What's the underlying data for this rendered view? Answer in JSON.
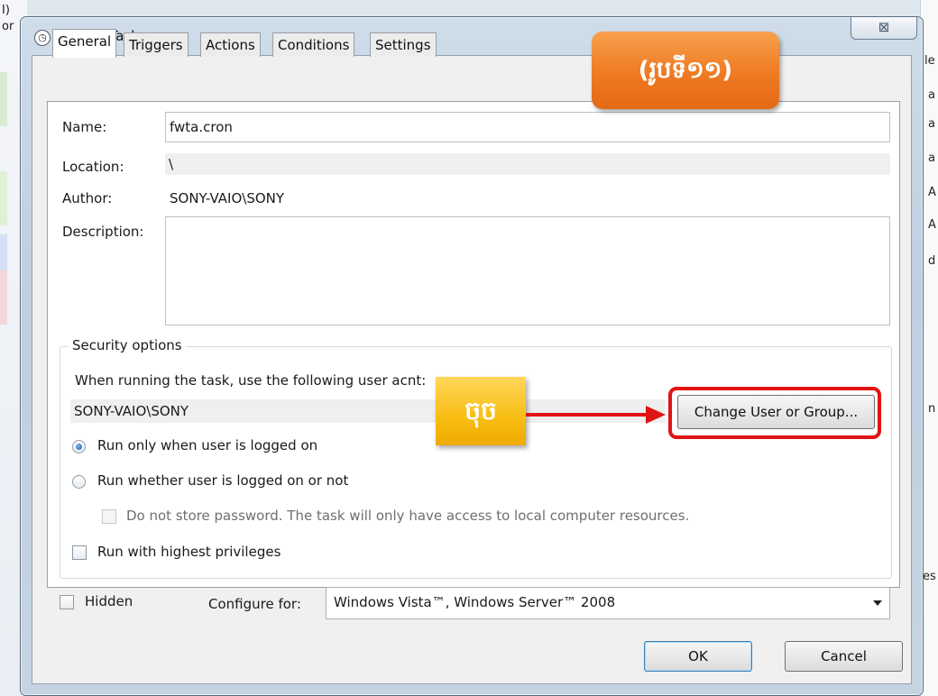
{
  "background": {
    "left_text": "I)",
    "left_text2": "or",
    "right_chars": [
      "le",
      "a",
      "a",
      "a",
      "A",
      "A",
      "d",
      "n",
      "es"
    ]
  },
  "window": {
    "title": "Create Task",
    "close_symbol": "⊠"
  },
  "tabs": [
    {
      "label": "General",
      "active": true
    },
    {
      "label": "Triggers",
      "active": false
    },
    {
      "label": "Actions",
      "active": false
    },
    {
      "label": "Conditions",
      "active": false
    },
    {
      "label": "Settings",
      "active": false
    }
  ],
  "general": {
    "name_label": "Name:",
    "name_value": "fwta.cron",
    "location_label": "Location:",
    "location_value": "\\",
    "author_label": "Author:",
    "author_value": "SONY-VAIO\\SONY",
    "description_label": "Description:",
    "description_value": ""
  },
  "security": {
    "group_title": "Security options",
    "prompt": "When running the task, use the following user ac",
    "prompt_tail": "nt:",
    "user_account": "SONY-VAIO\\SONY",
    "change_button": "Change User or Group...",
    "radio_logged_on": "Run only when user is logged on",
    "radio_whether": "Run whether user is logged on or not",
    "radio_selected": "logged_on",
    "no_store_password": "Do not store password.  The task will only have access to local computer resources.",
    "highest_privileges": "Run with highest privileges"
  },
  "hidden_label": "Hidden",
  "configure": {
    "label": "Configure for:",
    "selected": "Windows Vista™, Windows Server™ 2008"
  },
  "buttons": {
    "ok": "OK",
    "cancel": "Cancel"
  },
  "annotations": {
    "figure_badge": "(រូបទី១១)",
    "click_badge": "ចុច",
    "highlight_color": "#e11414",
    "badge_orange_color": "#ef7a22",
    "badge_yellow_color": "#f8bd14"
  }
}
